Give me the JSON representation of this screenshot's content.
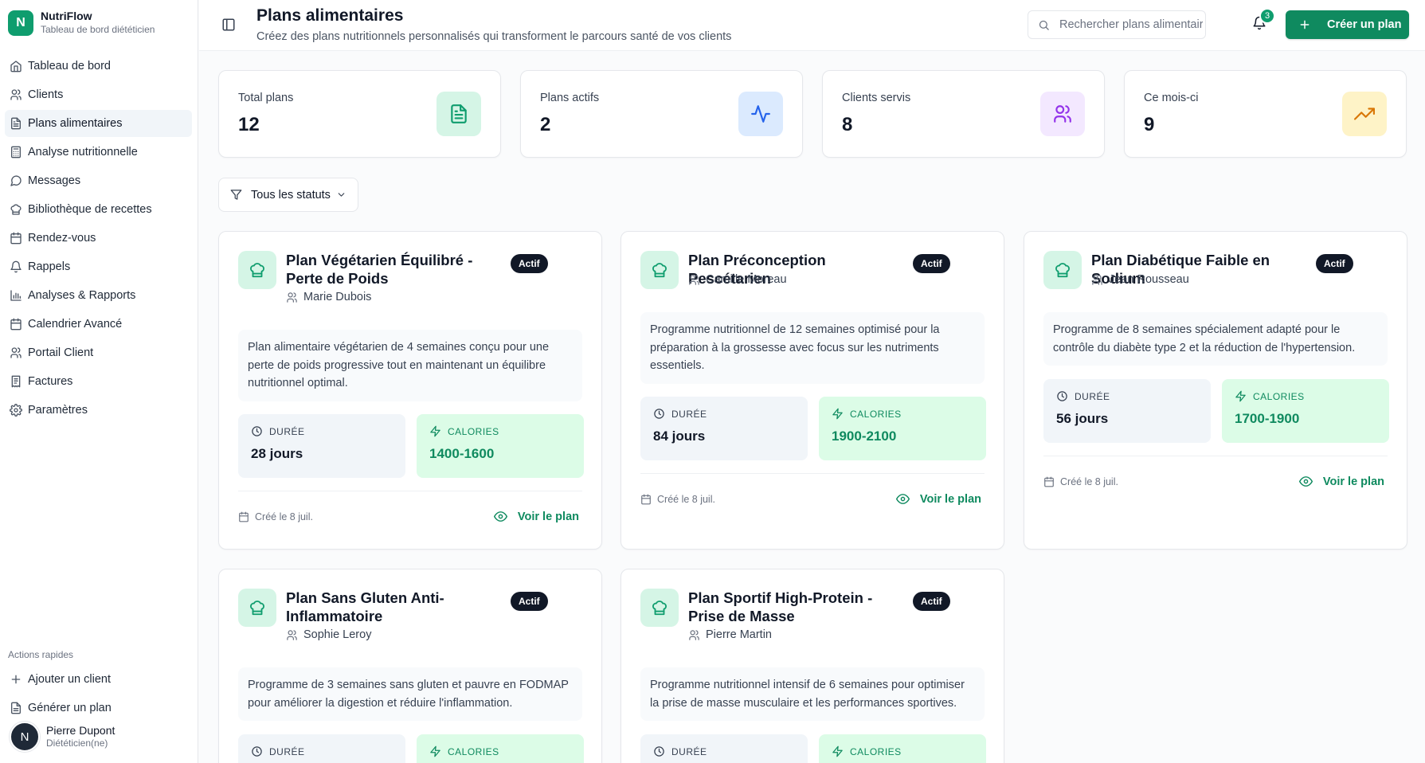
{
  "brand": {
    "logo_letter": "N",
    "name": "NutriFlow",
    "subtitle": "Tableau de bord diététicien"
  },
  "nav": [
    {
      "label": "Tableau de bord",
      "icon": "home-icon"
    },
    {
      "label": "Clients",
      "icon": "users-icon"
    },
    {
      "label": "Plans alimentaires",
      "icon": "file-text-icon",
      "active": true
    },
    {
      "label": "Analyse nutritionnelle",
      "icon": "calculator-icon"
    },
    {
      "label": "Messages",
      "icon": "message-circle-icon"
    },
    {
      "label": "Bibliothèque de recettes",
      "icon": "chef-hat-icon"
    },
    {
      "label": "Rendez-vous",
      "icon": "calendar-icon"
    },
    {
      "label": "Rappels",
      "icon": "bell-icon"
    },
    {
      "label": "Analyses & Rapports",
      "icon": "bar-chart-icon"
    },
    {
      "label": "Calendrier Avancé",
      "icon": "calendar-icon"
    },
    {
      "label": "Portail Client",
      "icon": "users-icon"
    },
    {
      "label": "Factures",
      "icon": "receipt-icon"
    },
    {
      "label": "Paramètres",
      "icon": "gear-icon"
    }
  ],
  "quick_actions": {
    "title": "Actions rapides",
    "items": [
      {
        "label": "Ajouter un client",
        "icon": "plus-icon"
      },
      {
        "label": "Générer un plan",
        "icon": "file-text-icon"
      }
    ]
  },
  "user": {
    "initial": "N",
    "name": "Pierre Dupont",
    "role": "Diététicien(ne)"
  },
  "header": {
    "title": "Plans alimentaires",
    "subtitle": "Créez des plans nutritionnels personnalisés qui transforment le parcours santé de vos clients",
    "search_placeholder": "Rechercher plans alimentaires",
    "notification_count": "3",
    "create_label": "Créer un plan"
  },
  "stats": [
    {
      "label": "Total plans",
      "value": "12",
      "icon": "file-text-icon",
      "color": "#0f9d6e",
      "bg": "#d5f5e6"
    },
    {
      "label": "Plans actifs",
      "value": "2",
      "icon": "activity-icon",
      "color": "#2563eb",
      "bg": "#dbeafe"
    },
    {
      "label": "Clients servis",
      "value": "8",
      "icon": "users-icon",
      "color": "#9333ea",
      "bg": "#f3e8ff"
    },
    {
      "label": "Ce mois-ci",
      "value": "9",
      "icon": "trending-up-icon",
      "color": "#d97706",
      "bg": "#fef3c7"
    }
  ],
  "filter": {
    "label": "Tous les statuts"
  },
  "plan_labels": {
    "duration": "DURÉE",
    "calories": "CALORIES",
    "view": "Voir le plan"
  },
  "plans": [
    {
      "title": "Plan Végétarien Équilibré - Perte de Poids",
      "status": "Actif",
      "client": "Marie Dubois",
      "description": "Plan alimentaire végétarien de 4 semaines conçu pour une perte de poids progressive tout en maintenant un équilibre nutritionnel optimal.",
      "duration": "28 jours",
      "calories": "1400-1600",
      "created": "Créé le 8 juil."
    },
    {
      "title": "Plan Préconception Pescétarien",
      "status": "Actif",
      "client": "Camille Moreau",
      "description": "Programme nutritionnel de 12 semaines optimisé pour la préparation à la grossesse avec focus sur les nutriments essentiels.",
      "duration": "84 jours",
      "calories": "1900-2100",
      "created": "Créé le 8 juil."
    },
    {
      "title": "Plan Diabétique Faible en Sodium",
      "status": "Actif",
      "client": "Jean Rousseau",
      "description": "Programme de 8 semaines spécialement adapté pour le contrôle du diabète type 2 et la réduction de l'hypertension.",
      "duration": "56 jours",
      "calories": "1700-1900",
      "created": "Créé le 8 juil."
    },
    {
      "title": "Plan Sans Gluten Anti-Inflammatoire",
      "status": "Actif",
      "client": "Sophie Leroy",
      "description": "Programme de 3 semaines sans gluten et pauvre en FODMAP pour améliorer la digestion et réduire l'inflammation.",
      "duration": "",
      "calories": "",
      "created": ""
    },
    {
      "title": "Plan Sportif High-Protein - Prise de Masse",
      "status": "Actif",
      "client": "Pierre Martin",
      "description": "Programme nutritionnel intensif de 6 semaines pour optimiser la prise de masse musculaire et les performances sportives.",
      "duration": "",
      "calories": "",
      "created": ""
    }
  ]
}
